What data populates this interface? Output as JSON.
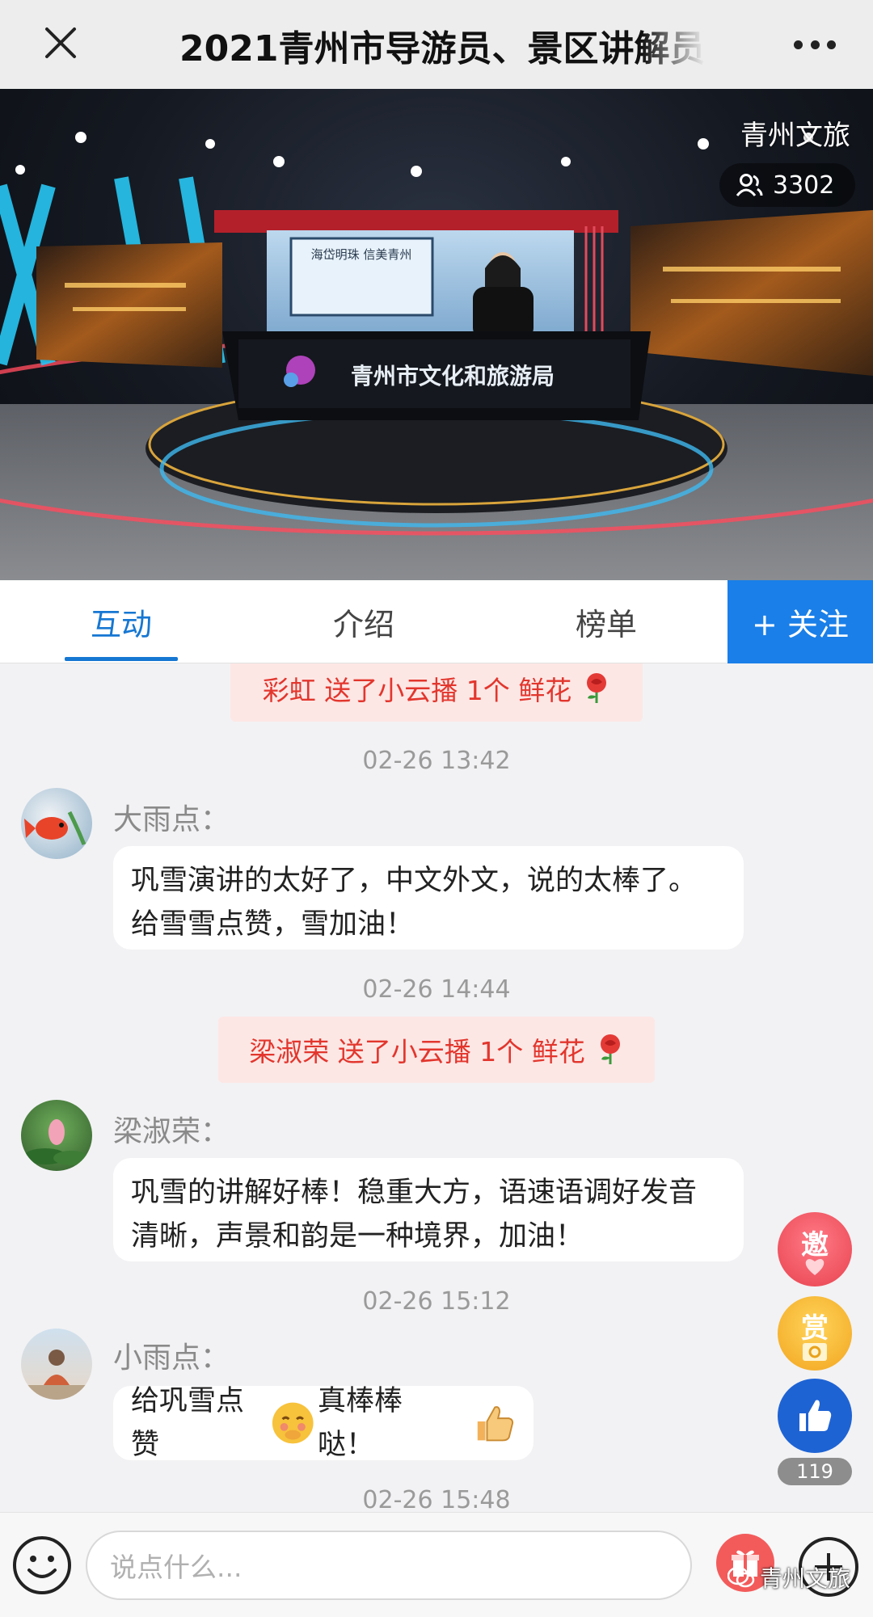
{
  "header": {
    "title": "2021青州市导游员、景区讲解员"
  },
  "video": {
    "channel_name": "青州文旅",
    "viewer_count": "3302",
    "stage_desk_text": "青州市文化和旅游局",
    "screen_text": "海岱明珠 信美青州"
  },
  "tabs": {
    "interact": "互动",
    "intro": "介绍",
    "ranking": "榜单",
    "follow_label": "+ 关注"
  },
  "chat": {
    "gifts": [
      {
        "text": "彩虹 送了小云播 1个 鲜花"
      },
      {
        "text": "梁淑荣 送了小云播 1个 鲜花"
      }
    ],
    "times": [
      "02-26 13:42",
      "02-26 14:44",
      "02-26 15:12",
      "02-26 15:48"
    ],
    "messages": [
      {
        "user": "大雨点：",
        "line1": "巩雪演讲的太好了，中文外文，说的太棒了。",
        "line2": "给雪雪点赞，雪加油！"
      },
      {
        "user": "梁淑荣：",
        "line1": "巩雪的讲解好棒！稳重大方，语速语调好发音",
        "line2": "清晰，声景和韵是一种境界，加油！"
      },
      {
        "user": "小雨点：",
        "part1": "给巩雪点赞",
        "part2": "真棒棒哒！"
      }
    ]
  },
  "side": {
    "invite": "邀",
    "reward": "赏",
    "likes": "119"
  },
  "bottom": {
    "input_placeholder": "说点什么...",
    "watermark": "青州文旅"
  },
  "colors": {
    "accent_blue": "#1a7fe8",
    "gift_red": "#e2362d",
    "gift_bg": "#fde7e5"
  }
}
